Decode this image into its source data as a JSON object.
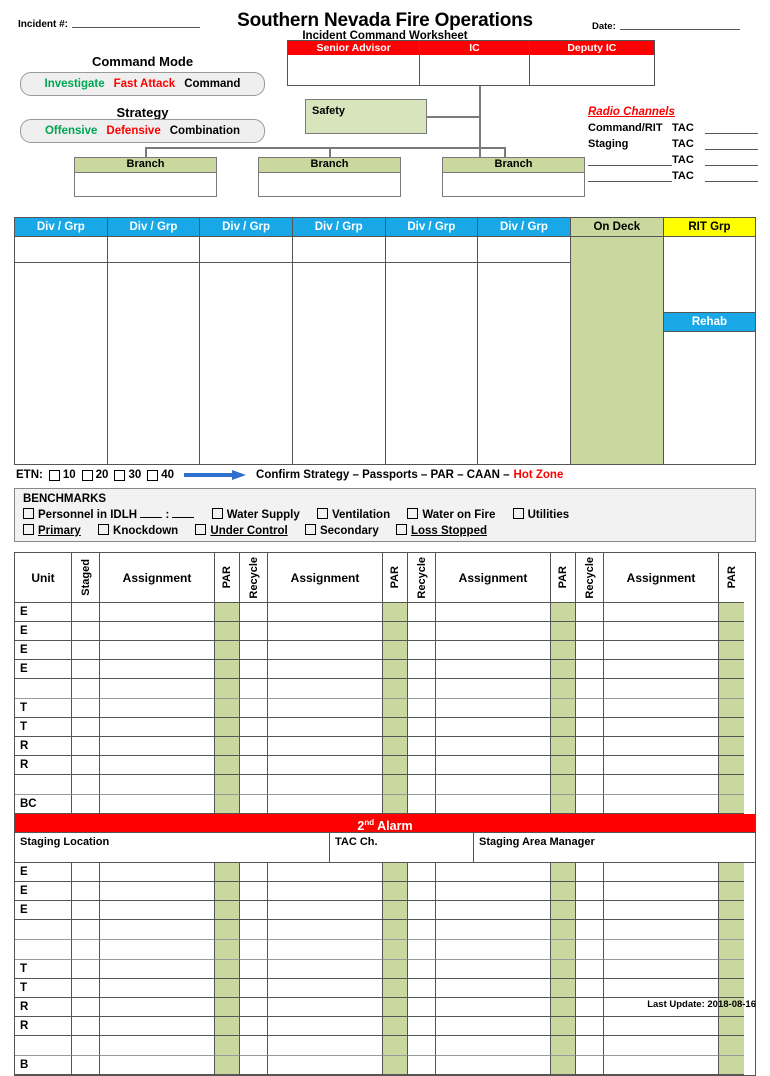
{
  "header": {
    "incident_label": "Incident #:",
    "title": "Southern Nevada Fire Operations",
    "subtitle": "Incident Command Worksheet",
    "date_label": "Date:"
  },
  "command_mode": {
    "label": "Command Mode",
    "options": [
      "Investigate",
      "Fast Attack",
      "Command"
    ],
    "colors": [
      "#00a651",
      "#ff0000",
      "#000000"
    ]
  },
  "strategy": {
    "label": "Strategy",
    "options": [
      "Offensive",
      "Defensive",
      "Combination"
    ],
    "colors": [
      "#00a651",
      "#ff0000",
      "#000000"
    ]
  },
  "org_chart": {
    "command_headers": [
      "Senior Advisor",
      "IC",
      "Deputy IC"
    ],
    "safety_label": "Safety",
    "branch_label": "Branch",
    "branch_count": 3
  },
  "radio_channels": {
    "title": "Radio Channels",
    "rows": [
      {
        "name": "Command/RIT",
        "tac": "TAC"
      },
      {
        "name": "Staging",
        "tac": "TAC"
      },
      {
        "name": "",
        "tac": "TAC"
      },
      {
        "name": "",
        "tac": "TAC"
      }
    ]
  },
  "div_grp_table": {
    "div_label": "Div / Grp",
    "div_count": 6,
    "on_deck_label": "On Deck",
    "rit_label": "RIT Grp",
    "rehab_label": "Rehab",
    "colors": {
      "div_header": "#18a8e8",
      "on_deck": "#cad79e",
      "rit_header": "#ffff00",
      "rehab": "#18a8e8"
    }
  },
  "etn": {
    "label": "ETN:",
    "times": [
      "10",
      "20",
      "30",
      "40"
    ],
    "sequence": "Confirm Strategy – Passports – PAR – CAAN –",
    "hot_zone": "Hot Zone"
  },
  "benchmarks": {
    "title": "BENCHMARKS",
    "row1": [
      {
        "label": "Personnel in IDLH",
        "has_time": true
      },
      {
        "label": "Water Supply",
        "has_time": false
      },
      {
        "label": "Ventilation",
        "has_time": false
      },
      {
        "label": "Water on Fire",
        "has_time": false
      },
      {
        "label": "Utilities",
        "has_time": false
      }
    ],
    "row2": [
      {
        "label": "Primary",
        "underline": true
      },
      {
        "label": "Knockdown",
        "underline": false
      },
      {
        "label": "Under Control",
        "underline": true
      },
      {
        "label": "Secondary",
        "underline": false
      },
      {
        "label": "Loss Stopped",
        "underline": true
      }
    ]
  },
  "assignment_table": {
    "headers": {
      "unit": "Unit",
      "staged": "Staged",
      "assignment": "Assignment",
      "par": "PAR",
      "recycle": "Recycle"
    },
    "column_order": [
      "Unit",
      "Staged",
      "Assignment",
      "PAR",
      "Recycle",
      "Assignment",
      "PAR",
      "Recycle",
      "Assignment",
      "PAR",
      "Recycle",
      "Assignment",
      "PAR"
    ],
    "first_alarm_units": [
      "E",
      "E",
      "E",
      "E",
      "",
      "T",
      "T",
      "R",
      "R",
      "",
      "BC"
    ],
    "second_alarm_units": [
      "E",
      "E",
      "E",
      "",
      "",
      "T",
      "T",
      "R",
      "R",
      "",
      "B"
    ],
    "par_fill_color": "#cad79e"
  },
  "second_alarm": {
    "title": "2nd Alarm",
    "title_base": "2",
    "title_sup": "nd",
    "title_rest": " Alarm",
    "staging_location_label": "Staging Location",
    "tac_ch_label": "TAC Ch.",
    "staging_manager_label": "Staging Area Manager"
  },
  "footer": {
    "last_update": "Last Update: 2018-08-16"
  }
}
